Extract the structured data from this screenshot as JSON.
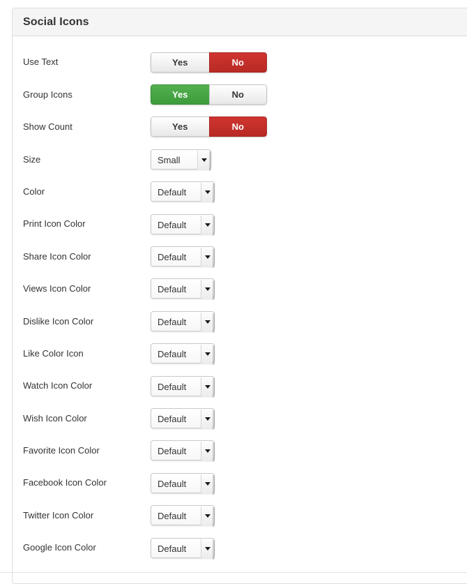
{
  "panel": {
    "title": "Social Icons"
  },
  "toggle_labels": {
    "yes": "Yes",
    "no": "No"
  },
  "colors": {
    "toggle_on_red": "#c9302c",
    "toggle_on_green": "#4ba949",
    "toggle_off_bg": "#eeeeee",
    "panel_header_bg": "#f5f5f5",
    "panel_border": "#dddddd",
    "label_text": "#333333"
  },
  "rows": [
    {
      "label": "Use Text",
      "type": "toggle",
      "selected": "no",
      "value": "No"
    },
    {
      "label": "Group Icons",
      "type": "toggle",
      "selected": "yes",
      "value": "Yes"
    },
    {
      "label": "Show Count",
      "type": "toggle",
      "selected": "no",
      "value": "No"
    },
    {
      "label": "Size",
      "type": "select",
      "value": "Small",
      "width": "w-size"
    },
    {
      "label": "Color",
      "type": "select",
      "value": "Default",
      "width": "w-color"
    },
    {
      "label": "Print Icon Color",
      "type": "select",
      "value": "Default",
      "width": "w-color"
    },
    {
      "label": "Share Icon Color",
      "type": "select",
      "value": "Default",
      "width": "w-color"
    },
    {
      "label": "Views Icon Color",
      "type": "select",
      "value": "Default",
      "width": "w-color"
    },
    {
      "label": "Dislike Icon Color",
      "type": "select",
      "value": "Default",
      "width": "w-color"
    },
    {
      "label": "Like Color Icon",
      "type": "select",
      "value": "Default",
      "width": "w-color"
    },
    {
      "label": "Watch Icon Color",
      "type": "select",
      "value": "Default",
      "width": "w-color"
    },
    {
      "label": "Wish Icon Color",
      "type": "select",
      "value": "Default",
      "width": "w-color"
    },
    {
      "label": "Favorite Icon Color",
      "type": "select",
      "value": "Default",
      "width": "w-color"
    },
    {
      "label": "Facebook Icon Color",
      "type": "select",
      "value": "Default",
      "width": "w-color"
    },
    {
      "label": "Twitter Icon Color",
      "type": "select",
      "value": "Default",
      "width": "w-color"
    },
    {
      "label": "Google Icon Color",
      "type": "select",
      "value": "Default",
      "width": "w-color"
    }
  ]
}
